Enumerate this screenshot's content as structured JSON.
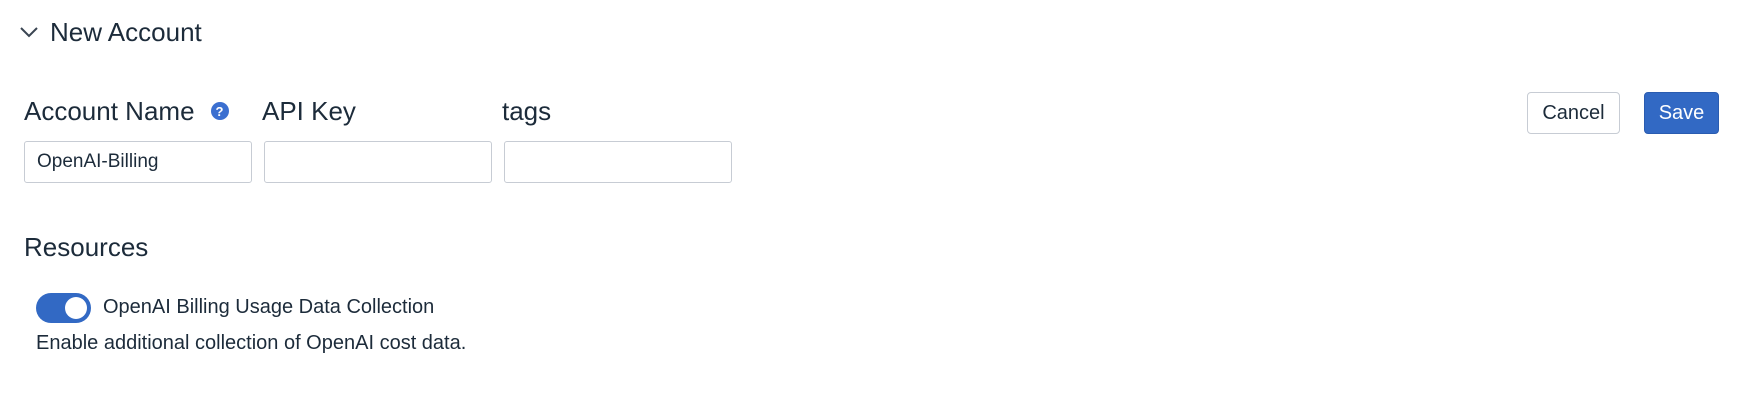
{
  "section": {
    "title": "New Account",
    "chevron_icon": "chevron-down-icon"
  },
  "form": {
    "account_name": {
      "label": "Account Name",
      "help_icon": "question-circle-icon",
      "value": "OpenAI-Billing"
    },
    "api_key": {
      "label": "API Key",
      "value": ""
    },
    "tags": {
      "label": "tags",
      "value": ""
    }
  },
  "actions": {
    "cancel_label": "Cancel",
    "save_label": "Save"
  },
  "resources": {
    "title": "Resources",
    "items": [
      {
        "label": "OpenAI Billing Usage Data Collection",
        "description": "Enable additional collection of OpenAI cost data.",
        "enabled": true
      }
    ]
  },
  "colors": {
    "accent": "#3269c4",
    "text": "#1c2b3a",
    "border": "#c7ccd4"
  }
}
